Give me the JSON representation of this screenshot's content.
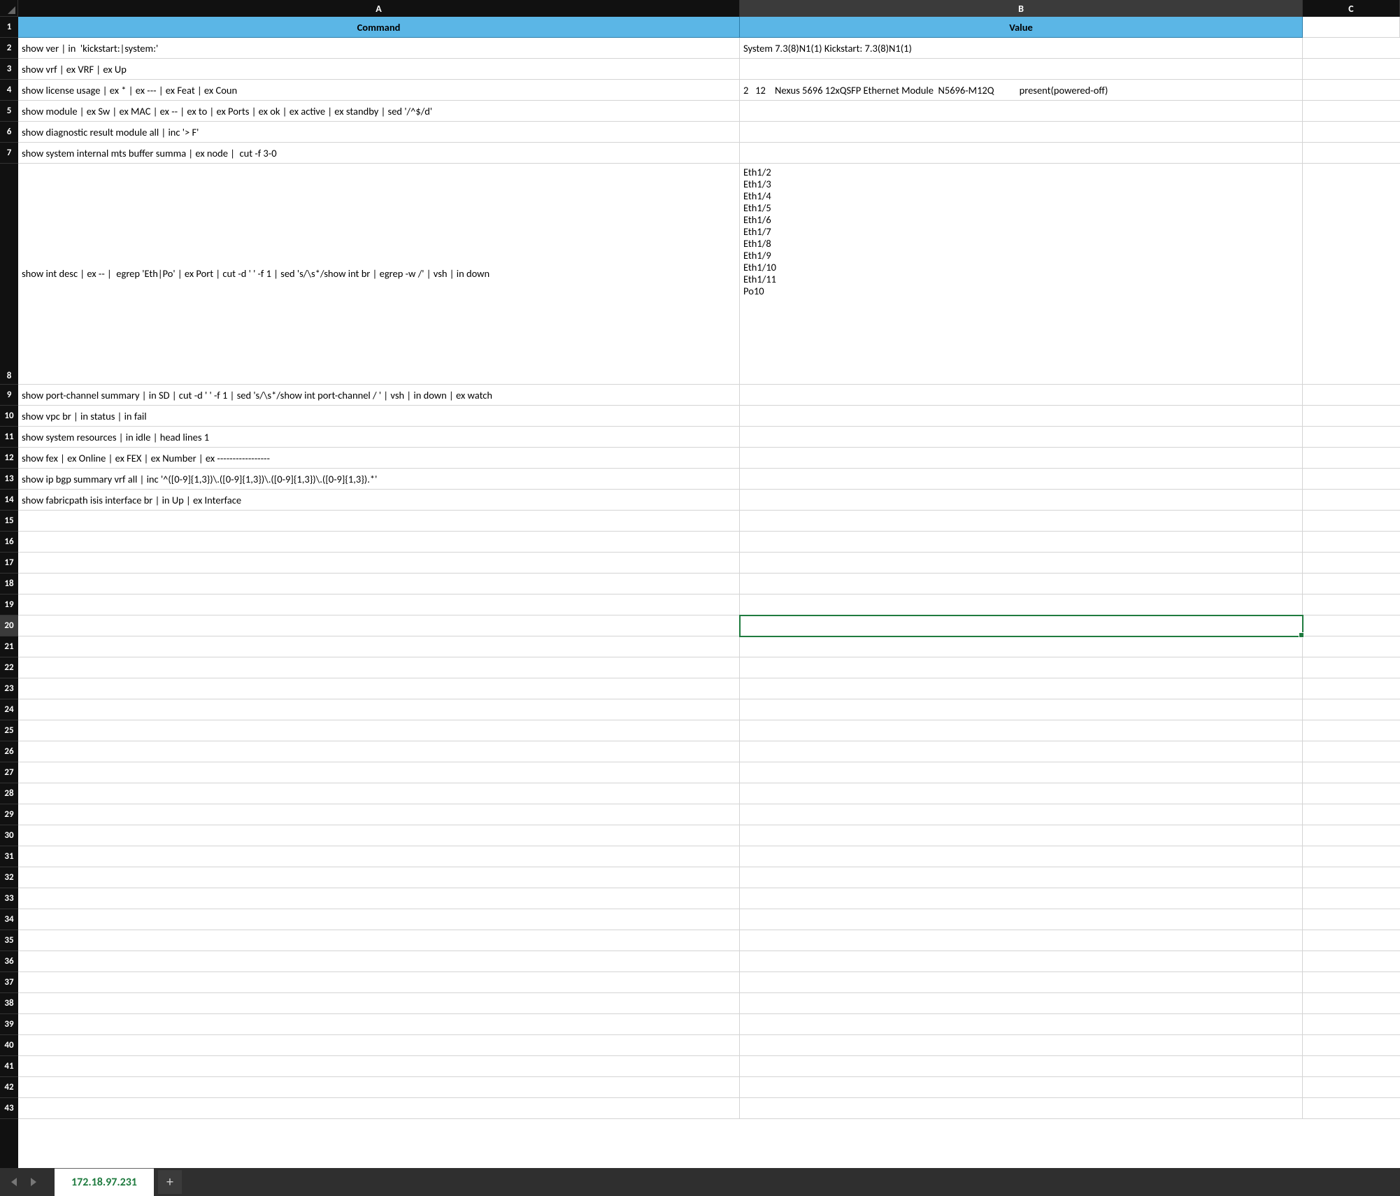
{
  "columns": {
    "A": "A",
    "B": "B",
    "C": "C",
    "headerA": "Command",
    "headerB": "Value"
  },
  "rows": [
    {
      "n": 2,
      "A": "show ver | in  'kickstart:|system:'",
      "B": "System 7.3(8)N1(1) Kickstart: 7.3(8)N1(1)"
    },
    {
      "n": 3,
      "A": "show vrf | ex VRF | ex Up",
      "B": ""
    },
    {
      "n": 4,
      "A": "show license usage | ex * | ex --- | ex Feat | ex Coun",
      "B": "2   12    Nexus 5696 12xQSFP Ethernet Module  N5696-M12Q           present(powered-off)"
    },
    {
      "n": 5,
      "A": "show module | ex Sw | ex MAC | ex -- | ex to | ex Ports | ex ok | ex active | ex standby | sed '/^$/d'",
      "B": ""
    },
    {
      "n": 6,
      "A": "show diagnostic result module all | inc '> F'",
      "B": ""
    },
    {
      "n": 7,
      "A": "show system internal mts buffer summa | ex node |  cut -f 3-0",
      "B": ""
    },
    {
      "n": 8,
      "A": "show int desc | ex -- |  egrep 'Eth|Po' | ex Port | cut -d ' ' -f 1 | sed 's/\\s*/show int br | egrep -w /' | vsh | in down",
      "B": "Eth1/2\nEth1/3\nEth1/4\nEth1/5\nEth1/6\nEth1/7\nEth1/8\nEth1/9\nEth1/10\nEth1/11\nPo10"
    },
    {
      "n": 9,
      "A": "show port-channel summary | in SD | cut -d ' ' -f 1 | sed 's/\\s*/show int port-channel / ' | vsh | in down | ex watch",
      "B": ""
    },
    {
      "n": 10,
      "A": "show vpc br | in status | in fail",
      "B": ""
    },
    {
      "n": 11,
      "A": "show system resources | in idle | head lines 1",
      "B": ""
    },
    {
      "n": 12,
      "A": "show fex | ex Online | ex FEX | ex Number | ex -----------------",
      "B": ""
    },
    {
      "n": 13,
      "A": "show ip bgp summary vrf all | inc '^([0-9]{1,3})\\.([0-9]{1,3})\\.([0-9]{1,3})\\.([0-9]{1,3}).*'",
      "B": ""
    },
    {
      "n": 14,
      "A": "show fabricpath isis interface br | in Up | ex Interface",
      "B": ""
    }
  ],
  "emptyRows": [
    15,
    16,
    17,
    18,
    19,
    20,
    21,
    22,
    23,
    24,
    25,
    26,
    27,
    28,
    29,
    30,
    31,
    32,
    33,
    34,
    35,
    36,
    37,
    38,
    39,
    40,
    41,
    42,
    43
  ],
  "selectedCell": {
    "row": 20,
    "col": "B"
  },
  "tab": {
    "name": "172.18.97.231"
  }
}
